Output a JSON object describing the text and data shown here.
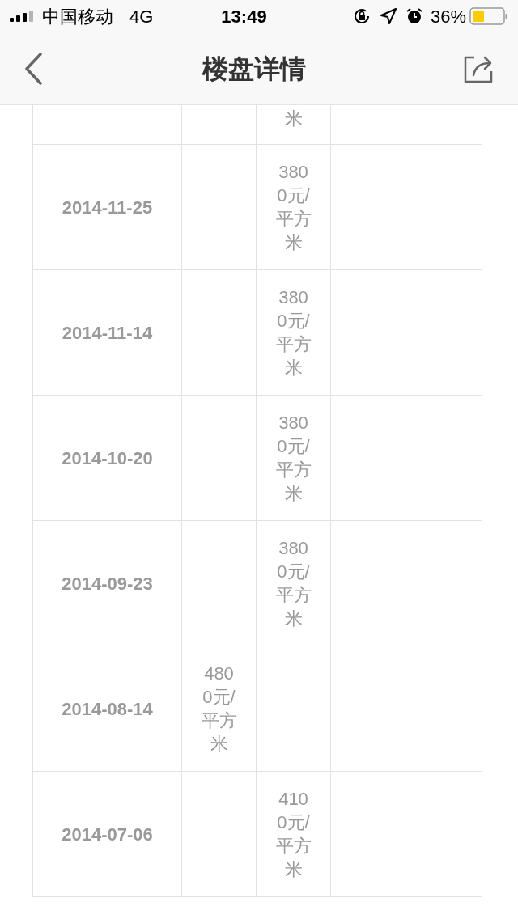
{
  "status_bar": {
    "carrier": "中国移动",
    "network": "4G",
    "time": "13:49",
    "battery": "36%"
  },
  "nav_bar": {
    "title": "楼盘详情"
  },
  "table": {
    "rows": [
      {
        "column_3": "米",
        "partial": true
      },
      {
        "date": "2014-11-25",
        "column_3": "3800元/平方米",
        "partial": false
      },
      {
        "date": "2014-11-14",
        "column_3": "3800元/平方米",
        "partial": false
      },
      {
        "date": "2014-10-20",
        "column_3": "3800元/平方米",
        "partial": false
      },
      {
        "date": "2014-09-23",
        "column_3": "3800元/平方米",
        "partial": false
      },
      {
        "date": "2014-08-14",
        "column_2": "4800元/平方米",
        "partial": false
      },
      {
        "date": "2014-07-06",
        "column_3": "4100元/平方米",
        "partial": false
      }
    ]
  }
}
